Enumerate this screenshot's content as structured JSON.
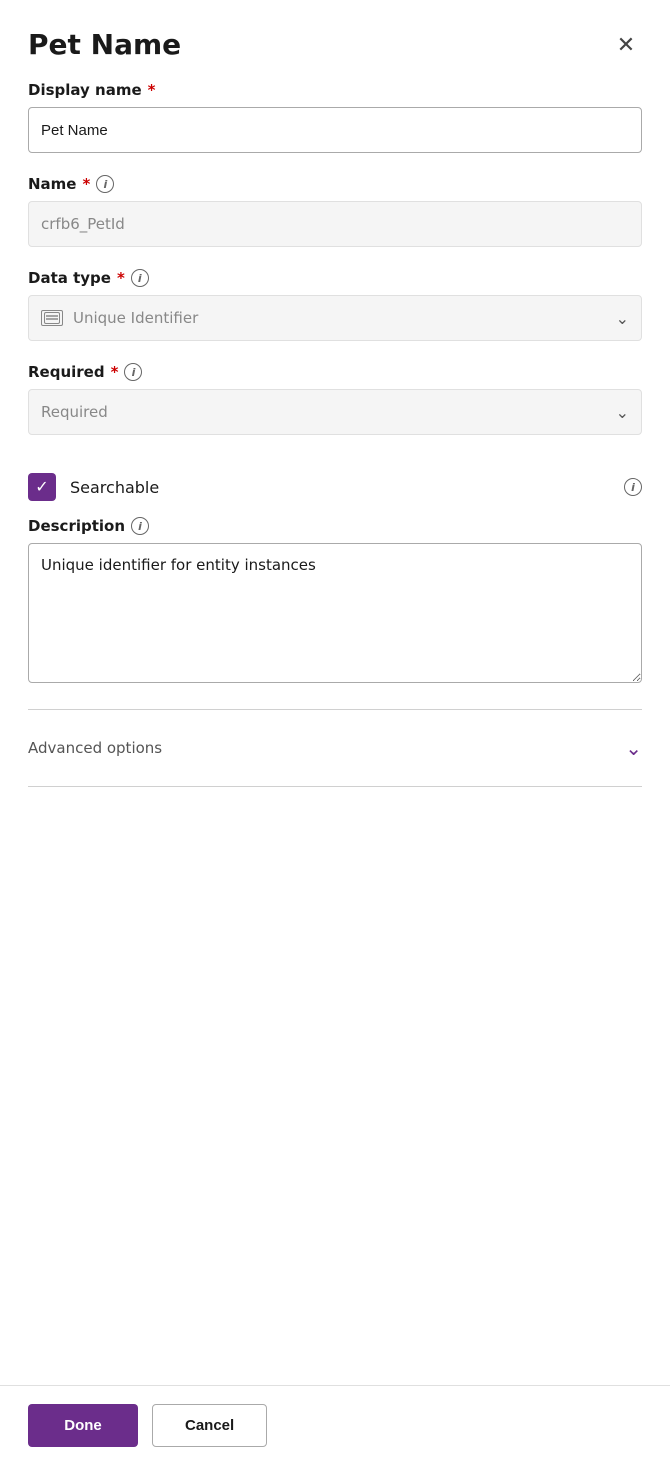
{
  "panel": {
    "title": "Pet Name",
    "close_label": "×"
  },
  "display_name": {
    "label": "Display name",
    "required": "*",
    "value": "Pet Name",
    "placeholder": "Pet Name"
  },
  "name_field": {
    "label": "Name",
    "required": "*",
    "value": "crfb6_PetId",
    "info": "i"
  },
  "data_type": {
    "label": "Data type",
    "required": "*",
    "value": "Unique Identifier",
    "info": "i"
  },
  "required_field": {
    "label": "Required",
    "required": "*",
    "value": "Required",
    "info": "i"
  },
  "searchable": {
    "label": "Searchable",
    "checked": true,
    "info": "i"
  },
  "description": {
    "label": "Description",
    "info": "i",
    "value": "Unique identifier for entity instances"
  },
  "advanced_options": {
    "label": "Advanced options"
  },
  "footer": {
    "done_label": "Done",
    "cancel_label": "Cancel"
  }
}
